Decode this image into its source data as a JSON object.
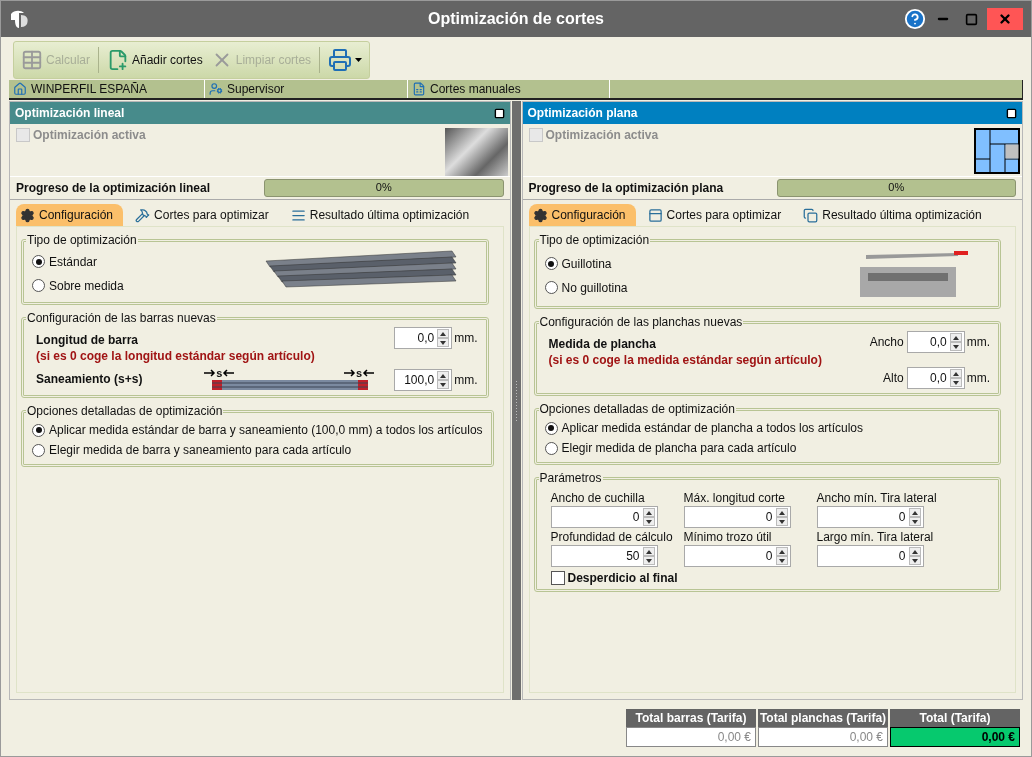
{
  "window": {
    "title": "Optimización de cortes"
  },
  "toolbar": [
    {
      "kind": "button",
      "label": "Calcular",
      "disabled": true
    },
    {
      "kind": "button",
      "label": "Añadir cortes",
      "disabled": false
    },
    {
      "kind": "button",
      "label": "Limpiar cortes",
      "disabled": true
    },
    {
      "kind": "dropdown"
    }
  ],
  "info_bar": [
    {
      "label": "WINPERFIL ESPAÑA"
    },
    {
      "label": "Supervisor"
    },
    {
      "label": "Cortes manuales"
    }
  ],
  "panels": [
    {
      "title": "Optimización lineal",
      "color": "#478b8b",
      "active_checkbox": {
        "label": "Optimización activa",
        "checked": false,
        "disabled": true
      },
      "progress": {
        "label": "Progreso de la optimización lineal",
        "level": 0,
        "reading": "0%"
      },
      "tabs": [
        {
          "label": "Configuración",
          "selected": true
        },
        {
          "label": "Cortes para optimizar",
          "selected": false
        },
        {
          "label": "Resultado última optimización",
          "selected": false
        }
      ],
      "sections": [
        {
          "kind": "type",
          "legend": "Tipo de optimización",
          "options": [
            {
              "label": "Estándar",
              "selected": true
            },
            {
              "label": "Sobre medida",
              "selected": false
            }
          ]
        },
        {
          "kind": "size",
          "legend": "Configuración de las barras nuevas",
          "title": "Longitud de barra",
          "note": "(si es 0 coge la longitud estándar según artículo)",
          "fields": [
            {
              "value": "0,0",
              "unit": "mm."
            }
          ],
          "trim": {
            "label": "Saneamiento (s+s)",
            "markers": [
              "s",
              "s"
            ],
            "value": "100,0",
            "unit": "mm."
          }
        },
        {
          "kind": "options",
          "legend": "Opciones detalladas de optimización",
          "options": [
            {
              "label": "Aplicar medida estándar de barra y saneamiento (100,0 mm) a todos los artículos",
              "selected": true
            },
            {
              "label": "Elegir medida de barra y saneamiento para cada artículo",
              "selected": false
            }
          ]
        }
      ]
    },
    {
      "title": "Optimización plana",
      "color": "#0080c0",
      "active_checkbox": {
        "label": "Optimización activa",
        "checked": false,
        "disabled": true
      },
      "progress": {
        "label": "Progreso de la optimización plana",
        "level": 0,
        "reading": "0%"
      },
      "tabs": [
        {
          "label": "Configuración",
          "selected": true
        },
        {
          "label": "Cortes para optimizar",
          "selected": false
        },
        {
          "label": "Resultado última optimización",
          "selected": false
        }
      ],
      "sections": [
        {
          "kind": "type",
          "legend": "Tipo de optimización",
          "options": [
            {
              "label": "Guillotina",
              "selected": true
            },
            {
              "label": "No guillotina",
              "selected": false
            }
          ]
        },
        {
          "kind": "size",
          "legend": "Configuración de las planchas nuevas",
          "title": "Medida de plancha",
          "note": "(si es 0 coge la medida estándar según artículo)",
          "fields": [
            {
              "label": "Ancho",
              "value": "0,0",
              "unit": "mm."
            },
            {
              "label": "Alto",
              "value": "0,0",
              "unit": "mm."
            }
          ]
        },
        {
          "kind": "options",
          "legend": "Opciones detalladas de optimización",
          "options": [
            {
              "label": "Aplicar medida estándar de plancha a todos los artículos",
              "selected": true
            },
            {
              "label": "Elegir medida de plancha para cada artículo",
              "selected": false
            }
          ]
        },
        {
          "kind": "parameters",
          "legend": "Parámetros",
          "fields": [
            {
              "label": "Ancho de cuchilla",
              "value": "0"
            },
            {
              "label": "Máx. longitud corte",
              "value": "0"
            },
            {
              "label": "Ancho mín. Tira lateral",
              "value": "0"
            },
            {
              "label": "Profundidad de cálculo",
              "value": "50"
            },
            {
              "label": "Mínimo trozo útil",
              "value": "0"
            },
            {
              "label": "Largo mín. Tira lateral",
              "value": "0"
            }
          ],
          "checkbox": {
            "label": "Desperdicio al final",
            "checked": false
          }
        }
      ]
    }
  ],
  "totals": [
    {
      "label": "Total barras (Tarifa)",
      "value": "0,00 €",
      "highlighted": false
    },
    {
      "label": "Total planchas (Tarifa)",
      "value": "0,00 €",
      "highlighted": false
    },
    {
      "label": "Total (Tarifa)",
      "value": "0,00 €",
      "highlighted": true
    }
  ]
}
